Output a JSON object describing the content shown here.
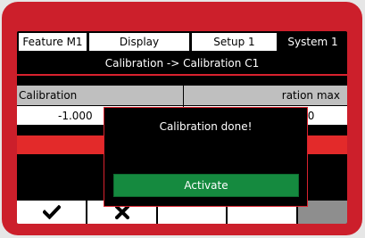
{
  "tabs": [
    {
      "label": "Feature  M1"
    },
    {
      "label": "Display"
    },
    {
      "label": "Setup 1"
    },
    {
      "label": "System 1"
    }
  ],
  "breadcrumb": "Calibration -> Calibration C1",
  "table": {
    "header_left": "Calibration",
    "header_right": "ration max",
    "value_left": "-1.000",
    "value_right": "1.000"
  },
  "dialog": {
    "message": "Calibration done!",
    "activate_label": "Activate"
  },
  "bottom_buttons": [
    {
      "icon": "check-icon"
    },
    {
      "icon": "x-icon"
    },
    {
      "icon": ""
    },
    {
      "icon": ""
    },
    {
      "icon": ""
    }
  ],
  "colors": {
    "frame": "#cc1f2b",
    "accent_red": "#e32a2a",
    "activate_green": "#158a3f",
    "header_gray": "#bfbfbf"
  }
}
